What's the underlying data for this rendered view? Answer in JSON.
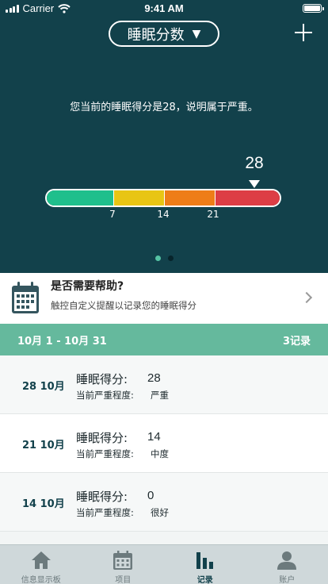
{
  "status_bar": {
    "carrier": "Carrier",
    "time": "9:41 AM"
  },
  "header": {
    "selector_label": "睡眠分数",
    "selector_caret": "▼",
    "add_icon": "plus-icon"
  },
  "score_panel": {
    "message": "您当前的睡眠得分是28，说明属于严重。",
    "score": "28",
    "scale_max": 28,
    "segment_colors": [
      "#1fbf8c",
      "#e8c514",
      "#ee7d18",
      "#dd3d45"
    ],
    "ticks": [
      "7",
      "14",
      "21"
    ],
    "page_count": 2,
    "active_page": 1
  },
  "help": {
    "icon": "calendar-icon",
    "title": "是否需要帮助?",
    "subtitle": "触控自定义提醒以记录您的睡眠得分"
  },
  "range": {
    "label": "10月 1 - 10月 31",
    "count": "3记录"
  },
  "records": [
    {
      "date": "28 10月",
      "score_label": "睡眠得分:",
      "score": "28",
      "severity_label": "当前严重程度:",
      "severity": "严重"
    },
    {
      "date": "21 10月",
      "score_label": "睡眠得分:",
      "score": "14",
      "severity_label": "当前严重程度:",
      "severity": "中度"
    },
    {
      "date": "14 10月",
      "score_label": "睡眠得分:",
      "score": "0",
      "severity_label": "当前严重程度:",
      "severity": "很好"
    }
  ],
  "tabs": [
    {
      "label": "信息显示板",
      "icon": "home-icon",
      "active": false
    },
    {
      "label": "项目",
      "icon": "calendar-icon",
      "active": false
    },
    {
      "label": "记录",
      "icon": "bar-chart-icon",
      "active": true
    },
    {
      "label": "账户",
      "icon": "person-icon",
      "active": false
    }
  ],
  "colors": {
    "header_bg": "#12414b",
    "accent": "#65b99d",
    "tab_bg": "#cfd8da"
  }
}
